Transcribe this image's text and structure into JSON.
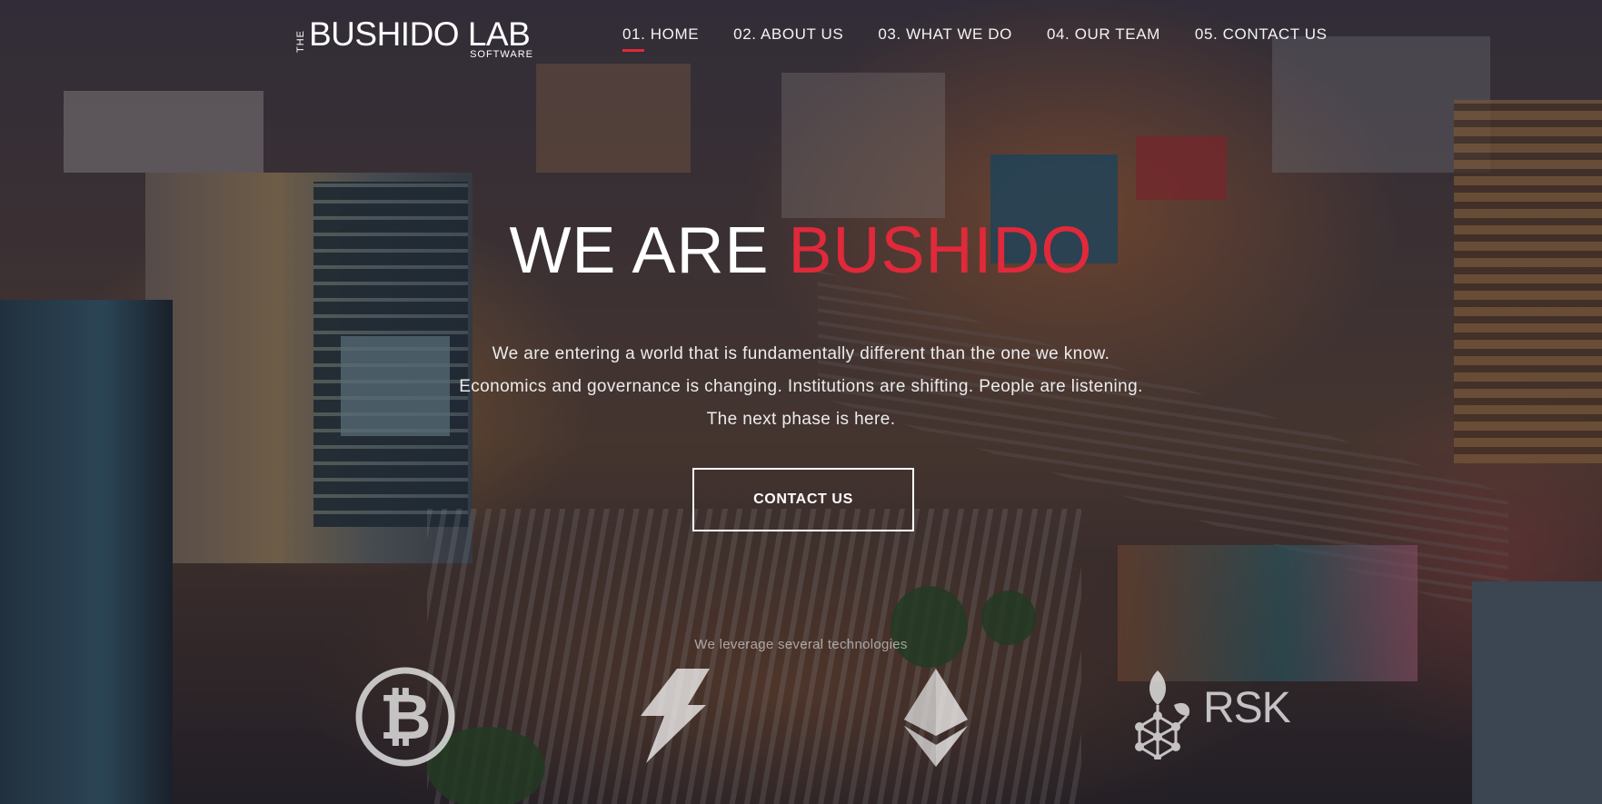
{
  "brand": {
    "prefix": "THE",
    "name": "BUSHIDO LAB",
    "subtitle": "SOFTWARE"
  },
  "nav": {
    "items": [
      {
        "label": "01. HOME",
        "active": true
      },
      {
        "label": "02. ABOUT US",
        "active": false
      },
      {
        "label": "03. WHAT WE DO",
        "active": false
      },
      {
        "label": "04. OUR TEAM",
        "active": false
      },
      {
        "label": "05. CONTACT US",
        "active": false
      }
    ]
  },
  "hero": {
    "title_lead": "WE ARE",
    "title_accent": "BUSHIDO",
    "lines": [
      "We are entering a world that is fundamentally different than the one we know.",
      "Economics and governance is changing. Institutions are shifting. People are listening.",
      "The next phase is here."
    ],
    "cta_label": "CONTACT US"
  },
  "technologies": {
    "caption": "We leverage several technologies",
    "items": [
      {
        "name": "bitcoin",
        "icon": "bitcoin-icon"
      },
      {
        "name": "lightning",
        "icon": "lightning-icon"
      },
      {
        "name": "ethereum",
        "icon": "ethereum-icon"
      },
      {
        "name": "rsk",
        "icon": "rsk-icon",
        "label": "RSK"
      }
    ]
  },
  "colors": {
    "accent": "#e0293a",
    "text": "#ffffff"
  }
}
